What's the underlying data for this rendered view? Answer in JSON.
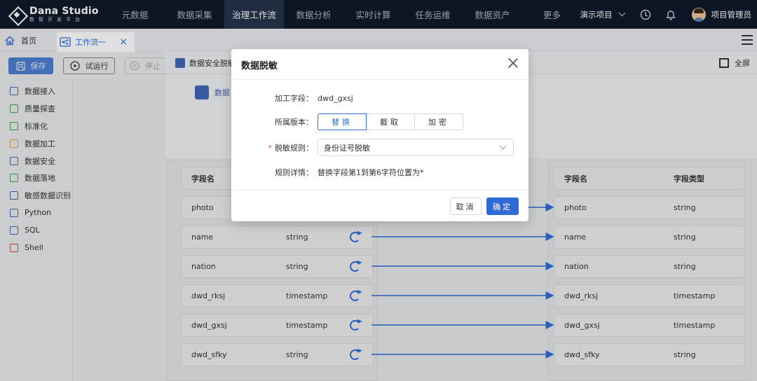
{
  "brand": {
    "title": "Dana Studio",
    "subtitle": "数智开发平台"
  },
  "nav": {
    "items": [
      "元数据",
      "数据采集",
      "治理工作流",
      "数据分析",
      "实时计算",
      "任务运维",
      "数据资产",
      "更多"
    ],
    "active_index": 2,
    "project": "演示项目",
    "user": "项目管理员"
  },
  "tabs": {
    "home": "首页",
    "work": "工作流一",
    "close": "×"
  },
  "toolbar": {
    "save": "保存",
    "run": "试运行",
    "stop": "停止"
  },
  "sidebar": {
    "items": [
      {
        "label": "数据接入",
        "color": "#3e66b5"
      },
      {
        "label": "质量探查",
        "color": "#3aa14a"
      },
      {
        "label": "标准化",
        "color": "#3aa14a"
      },
      {
        "label": "数据加工",
        "color": "#e8a43a"
      },
      {
        "label": "数据安全",
        "color": "#3e66b5"
      },
      {
        "label": "数据落地",
        "color": "#3aa14a"
      },
      {
        "label": "敏感数据识别",
        "color": "#3e66b5"
      },
      {
        "label": "Python",
        "color": "#3e66b5"
      },
      {
        "label": "SQL",
        "color": "#3e66b5"
      },
      {
        "label": "Shell",
        "color": "#d94b3b"
      }
    ]
  },
  "panel": {
    "title": "数据安全脱敏",
    "fullscreen": "全屏",
    "node_label": "数据"
  },
  "mapping": {
    "header": {
      "name": "字段名",
      "type": "字段类型"
    },
    "left_rows": [
      {
        "name": "photo",
        "type": "string"
      },
      {
        "name": "name",
        "type": "string"
      },
      {
        "name": "nation",
        "type": "string"
      },
      {
        "name": "dwd_rksj",
        "type": "timestamp"
      },
      {
        "name": "dwd_gxsj",
        "type": "timestamp"
      },
      {
        "name": "dwd_sfky",
        "type": "string"
      }
    ],
    "right_rows": [
      {
        "name": "photo",
        "type": "string"
      },
      {
        "name": "name",
        "type": "string"
      },
      {
        "name": "nation",
        "type": "string"
      },
      {
        "name": "dwd_rksj",
        "type": "timestamp"
      },
      {
        "name": "dwd_gxsj",
        "type": "timestamp"
      },
      {
        "name": "dwd_sfky",
        "type": "string"
      }
    ]
  },
  "dialog": {
    "title": "数据脱敏",
    "field_label": "加工字段：",
    "field_value": "dwd_gxsj",
    "version_label": "所属版本：",
    "versions": [
      "替换",
      "截取",
      "加密"
    ],
    "rule_label": "脱敏规则：",
    "rule_value": "身份证号脱敏",
    "detail_label": "规则详情：",
    "detail_value": "替换字段第1到第6字符位置为*",
    "cancel": "取消",
    "ok": "确定"
  },
  "colors": {
    "accent": "#2e6bd6",
    "nav_bg": "#0f1a2b"
  }
}
